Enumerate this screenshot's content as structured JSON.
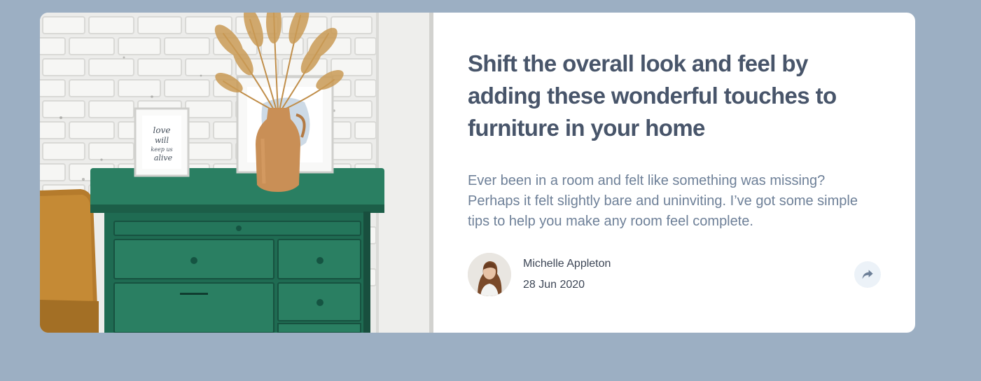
{
  "article": {
    "headline": "Shift the overall look and feel by adding these wonderful touches to furniture in your home",
    "excerpt": "Ever been in a room and felt like something was missing? Perhaps it felt slightly bare and uninviting. I’ve got some simple tips to help you make any room feel complete."
  },
  "author": {
    "name": "Michelle Appleton",
    "date": "28 Jun 2020"
  },
  "share": {
    "icon": "share-icon"
  },
  "image": {
    "frame_text": [
      "love",
      "will",
      "keep us",
      "alive"
    ]
  },
  "colors": {
    "background": "#9CAFC3",
    "card": "#FFFFFF",
    "headline": "#48556A",
    "excerpt": "#6E8098",
    "share_bg": "#ECF2F8",
    "share_icon": "#6E8098"
  }
}
